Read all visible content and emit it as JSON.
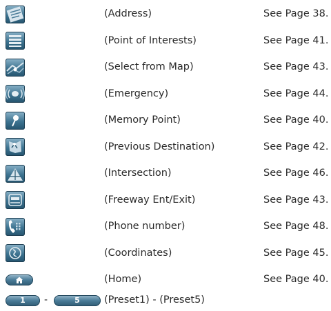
{
  "rows": [
    {
      "icon": "address-icon",
      "label": "(Address)",
      "page": "See Page 38."
    },
    {
      "icon": "point-of-interests-icon",
      "label": "(Point of Interests)",
      "page": "See Page 41."
    },
    {
      "icon": "select-from-map-icon",
      "label": "(Select from Map)",
      "page": "See Page 43."
    },
    {
      "icon": "emergency-icon",
      "label": "(Emergency)",
      "page": "See Page 44."
    },
    {
      "icon": "memory-point-icon",
      "label": "(Memory Point)",
      "page": "See Page 40."
    },
    {
      "icon": "previous-destination-icon",
      "label": "(Previous Destination)",
      "page": "See Page 42."
    },
    {
      "icon": "intersection-icon",
      "label": "(Intersection)",
      "page": "See Page 46."
    },
    {
      "icon": "freeway-ent-exit-icon",
      "label": "(Freeway Ent/Exit)",
      "page": "See Page 43."
    },
    {
      "icon": "phone-number-icon",
      "label": "(Phone number)",
      "page": "See Page 48."
    },
    {
      "icon": "coordinates-icon",
      "label": "(Coordinates)",
      "page": "See Page 45."
    },
    {
      "icon": "home-icon",
      "label": "(Home)",
      "page": "See Page 40."
    },
    {
      "icon": "preset-icons",
      "label": "(Preset1) - (Preset5)",
      "page": ""
    }
  ],
  "preset": {
    "first": "1",
    "last": "5",
    "separator": "-"
  }
}
